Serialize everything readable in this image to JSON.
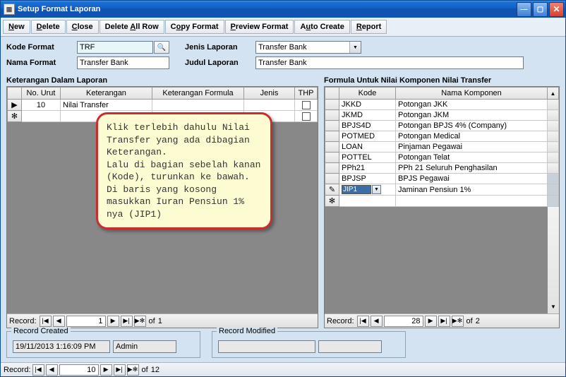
{
  "window": {
    "title": "Setup Format Laporan"
  },
  "menubar": {
    "new": "New",
    "new_u": "N",
    "delete": "Delete",
    "delete_u": "D",
    "close": "Close",
    "close_u": "C",
    "dar": "Delete All Row",
    "dar_u": "A",
    "copy": "Copy Format",
    "copy_u": "o",
    "preview": "Preview Format",
    "preview_u": "P",
    "auto": "Auto Create",
    "auto_u": "u",
    "report": "Report",
    "report_u": "R"
  },
  "form": {
    "kode_label": "Kode Format",
    "kode_value": "TRF",
    "nama_label": "Nama Format",
    "nama_value": "Transfer Bank",
    "jenis_label": "Jenis Laporan",
    "jenis_value": "Transfer Bank",
    "judul_label": "Judul Laporan",
    "judul_value": "Transfer Bank"
  },
  "left_panel": {
    "title": "Keterangan Dalam Laporan",
    "headers": {
      "no": "No. Urut",
      "ket": "Keterangan",
      "kf": "Keterangan Formula",
      "jenis": "Jenis",
      "thp": "THP"
    },
    "rows": [
      {
        "sel": "▶",
        "no": "10",
        "ket": "Nilai Transfer",
        "kf": "",
        "jenis": "",
        "thp": false
      },
      {
        "sel": "✻",
        "no": "",
        "ket": "",
        "kf": "",
        "jenis": "",
        "thp": false
      }
    ],
    "nav": {
      "label": "Record:",
      "current": "1",
      "of": "of",
      "total": "1"
    }
  },
  "right_panel": {
    "title": "Formula Untuk Nilai Komponen Nilai Transfer",
    "headers": {
      "kode": "Kode",
      "nama": "Nama Komponen"
    },
    "rows": [
      {
        "sel": "",
        "kode": "JKKD",
        "nama": "Potongan JKK"
      },
      {
        "sel": "",
        "kode": "JKMD",
        "nama": "Potongan JKM"
      },
      {
        "sel": "",
        "kode": "BPJS4D",
        "nama": "Potongan BPJS 4% (Company)"
      },
      {
        "sel": "",
        "kode": "POTMED",
        "nama": "Potongan Medical"
      },
      {
        "sel": "",
        "kode": "LOAN",
        "nama": "Pinjaman Pegawai"
      },
      {
        "sel": "",
        "kode": "POTTEL",
        "nama": "Potongan Telat"
      },
      {
        "sel": "",
        "kode": "PPh21",
        "nama": "PPh 21 Seluruh Penghasilan"
      },
      {
        "sel": "",
        "kode": "BPJSP",
        "nama": "BPJS Pegawai"
      },
      {
        "sel": "✎",
        "kode_edit": "JIP1",
        "nama": "Jaminan Pensiun 1%"
      },
      {
        "sel": "✻",
        "kode": "",
        "nama": ""
      }
    ],
    "nav": {
      "label": "Record:",
      "current": "28",
      "of": "of",
      "total": "2"
    }
  },
  "callout": "Klik terlebih dahulu Nilai Transfer yang ada dibagian Keterangan.\nLalu di bagian sebelah kanan (Kode), turunkan ke bawah.\nDi baris yang kosong masukkan Iuran Pensiun 1% nya (JIP1)",
  "record_created": {
    "legend": "Record Created",
    "date": "19/11/2013 1:16:09 PM",
    "user": "Admin"
  },
  "record_modified": {
    "legend": "Record Modified",
    "date": "",
    "user": ""
  },
  "bottom_nav": {
    "label": "Record:",
    "current": "10",
    "of": "of",
    "total": "12"
  },
  "glyphs": {
    "search": "🔍",
    "first": "|◀",
    "prev": "◀",
    "next": "▶",
    "last": "▶|",
    "new": "▶✻",
    "chevdown": "▼",
    "min": "—",
    "max": "▢",
    "close": "✕",
    "row_current": "▶",
    "row_new": "✻",
    "row_edit": "✎",
    "scroll_up": "▲",
    "scroll_dn": "▼"
  }
}
